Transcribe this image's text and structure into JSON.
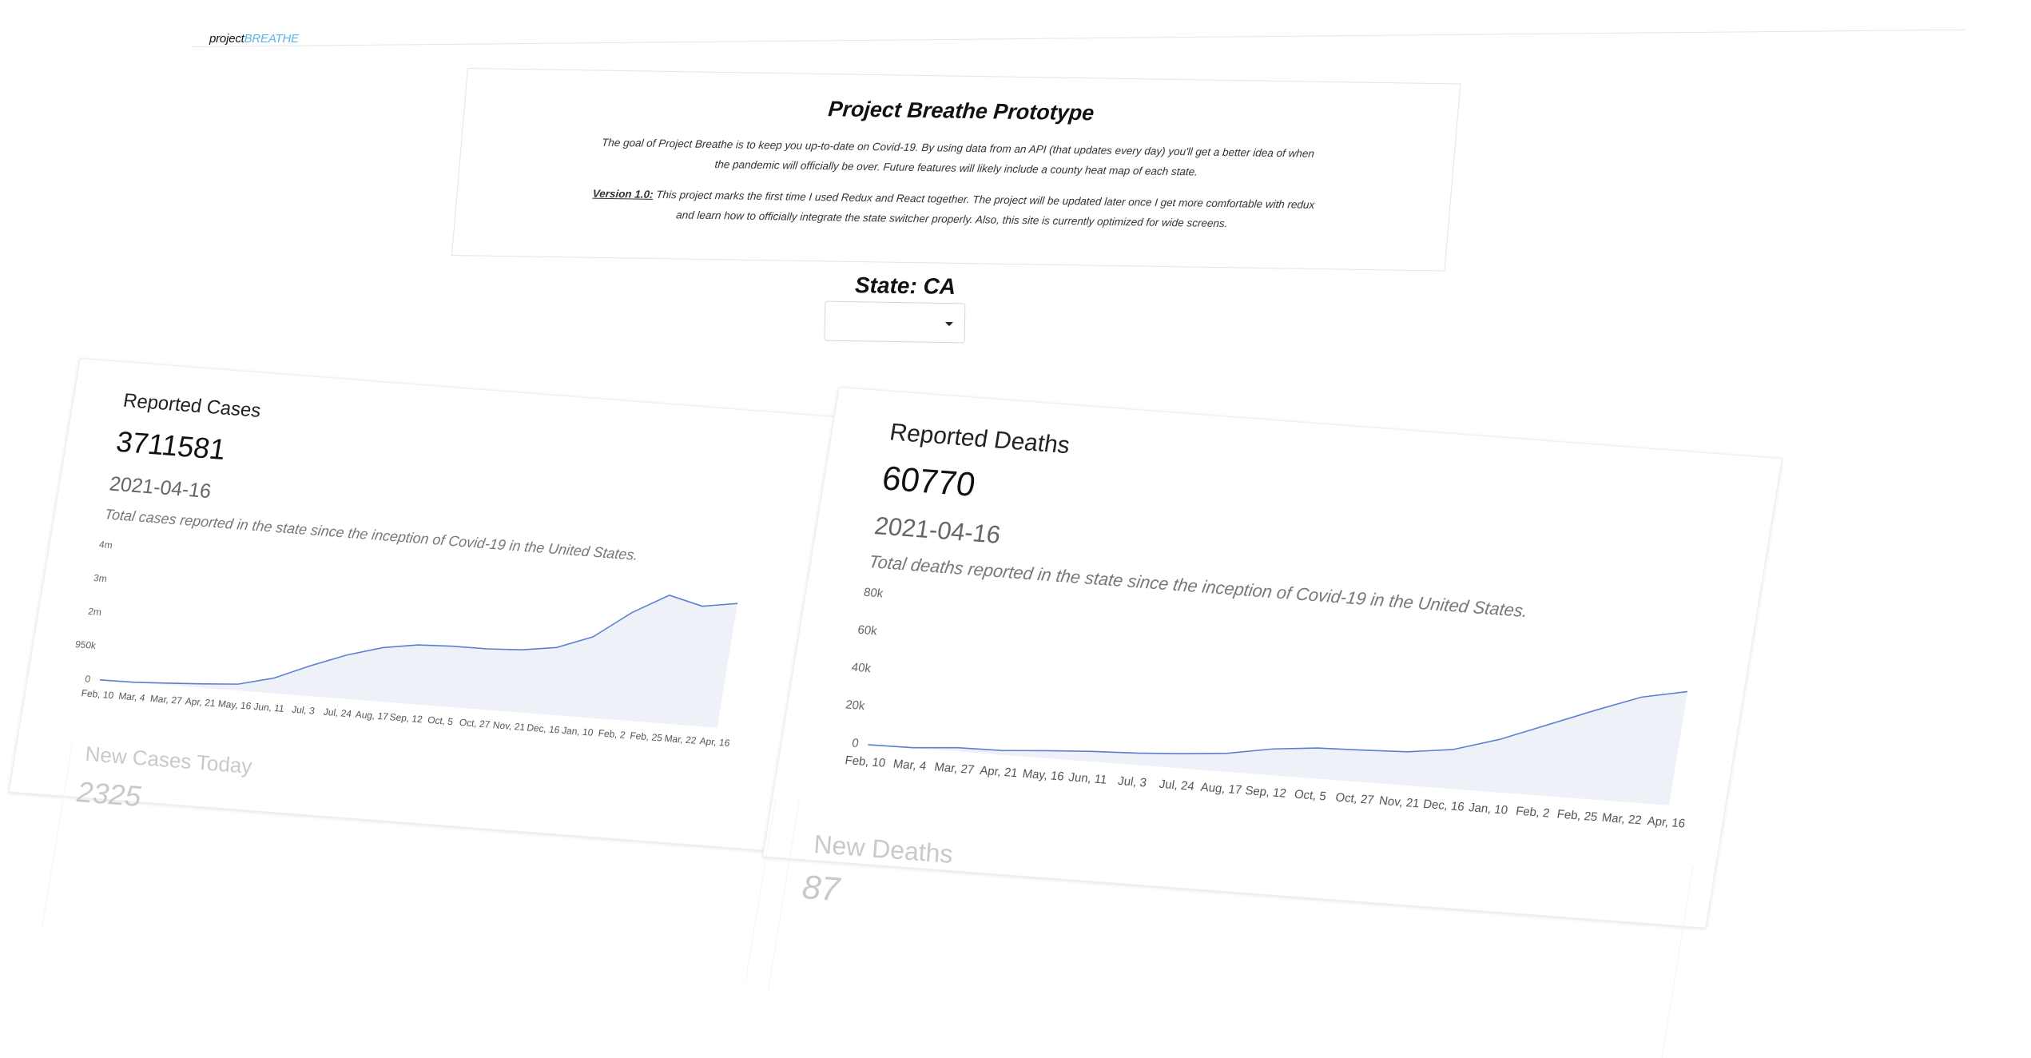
{
  "brand": {
    "prefix": "project",
    "accent": "BREATHE"
  },
  "intro": {
    "title": "Project Breathe Prototype",
    "paragraph1": "The goal of Project Breathe is to keep you up-to-date on Covid-19. By using data from an API (that updates every day) you'll get a better idea of when the pandemic will officially be over. Future features will likely include a county heat map of each state.",
    "version_label": "Version 1.0:",
    "paragraph2": " This project marks the first time I used Redux and React together. The project will be updated later once I get more comfortable with redux and learn how to officially integrate the state switcher properly. Also, this site is currently optimized for wide screens."
  },
  "state": {
    "label": "State: CA",
    "selected": ""
  },
  "cards": {
    "cases": {
      "title": "Reported Cases",
      "value": "3711581",
      "date": "2021-04-16",
      "description": "Total cases reported in the state since the inception of Covid-19 in the United States."
    },
    "deaths": {
      "title": "Reported Deaths",
      "value": "60770",
      "date": "2021-04-16",
      "description": "Total deaths reported in the state since the inception of Covid-19 in the United States."
    },
    "new_cases": {
      "title": "New Cases Today",
      "value": "2325"
    },
    "new_deaths": {
      "title": "New Deaths",
      "value": "87"
    }
  },
  "colors": {
    "line": "#5b7fd1",
    "fill": "#eef1f8",
    "accent": "#5bb4ea"
  },
  "chart_data": [
    {
      "type": "area",
      "title": "",
      "x": [
        "Feb, 10",
        "Mar, 4",
        "Mar, 27",
        "Apr, 21",
        "May, 16",
        "Jun, 11",
        "Jul, 3",
        "Jul, 24",
        "Aug, 17",
        "Sep, 12",
        "Oct, 5",
        "Oct, 27",
        "Nov, 21",
        "Dec, 16",
        "Jan, 10",
        "Feb, 2",
        "Feb, 25",
        "Mar, 22",
        "Apr, 16"
      ],
      "y": [
        0,
        8000,
        60000,
        120000,
        190000,
        450000,
        900000,
        1300000,
        1600000,
        1760000,
        1800000,
        1800000,
        1850000,
        2000000,
        2400000,
        3200000,
        3800000,
        3550000,
        3711581
      ],
      "ytick_labels": [
        "0",
        "950k",
        "2m",
        "3m",
        "4m"
      ],
      "ylim": [
        0,
        4000000
      ],
      "grid": false
    },
    {
      "type": "area",
      "title": "",
      "x": [
        "Feb, 10",
        "Mar, 4",
        "Mar, 27",
        "Apr, 21",
        "May, 16",
        "Jun, 11",
        "Jul, 3",
        "Jul, 24",
        "Aug, 17",
        "Sep, 12",
        "Oct, 5",
        "Oct, 27",
        "Nov, 21",
        "Dec, 16",
        "Jan, 10",
        "Feb, 2",
        "Feb, 25",
        "Mar, 22",
        "Apr, 16"
      ],
      "y": [
        0,
        200,
        2000,
        2300,
        4000,
        5400,
        6300,
        7800,
        9800,
        13900,
        16200,
        16900,
        17800,
        20800,
        28000,
        37500,
        47000,
        56000,
        60770
      ],
      "ytick_labels": [
        "0",
        "20k",
        "40k",
        "60k",
        "80k"
      ],
      "ylim": [
        0,
        80000
      ],
      "grid": false
    }
  ]
}
